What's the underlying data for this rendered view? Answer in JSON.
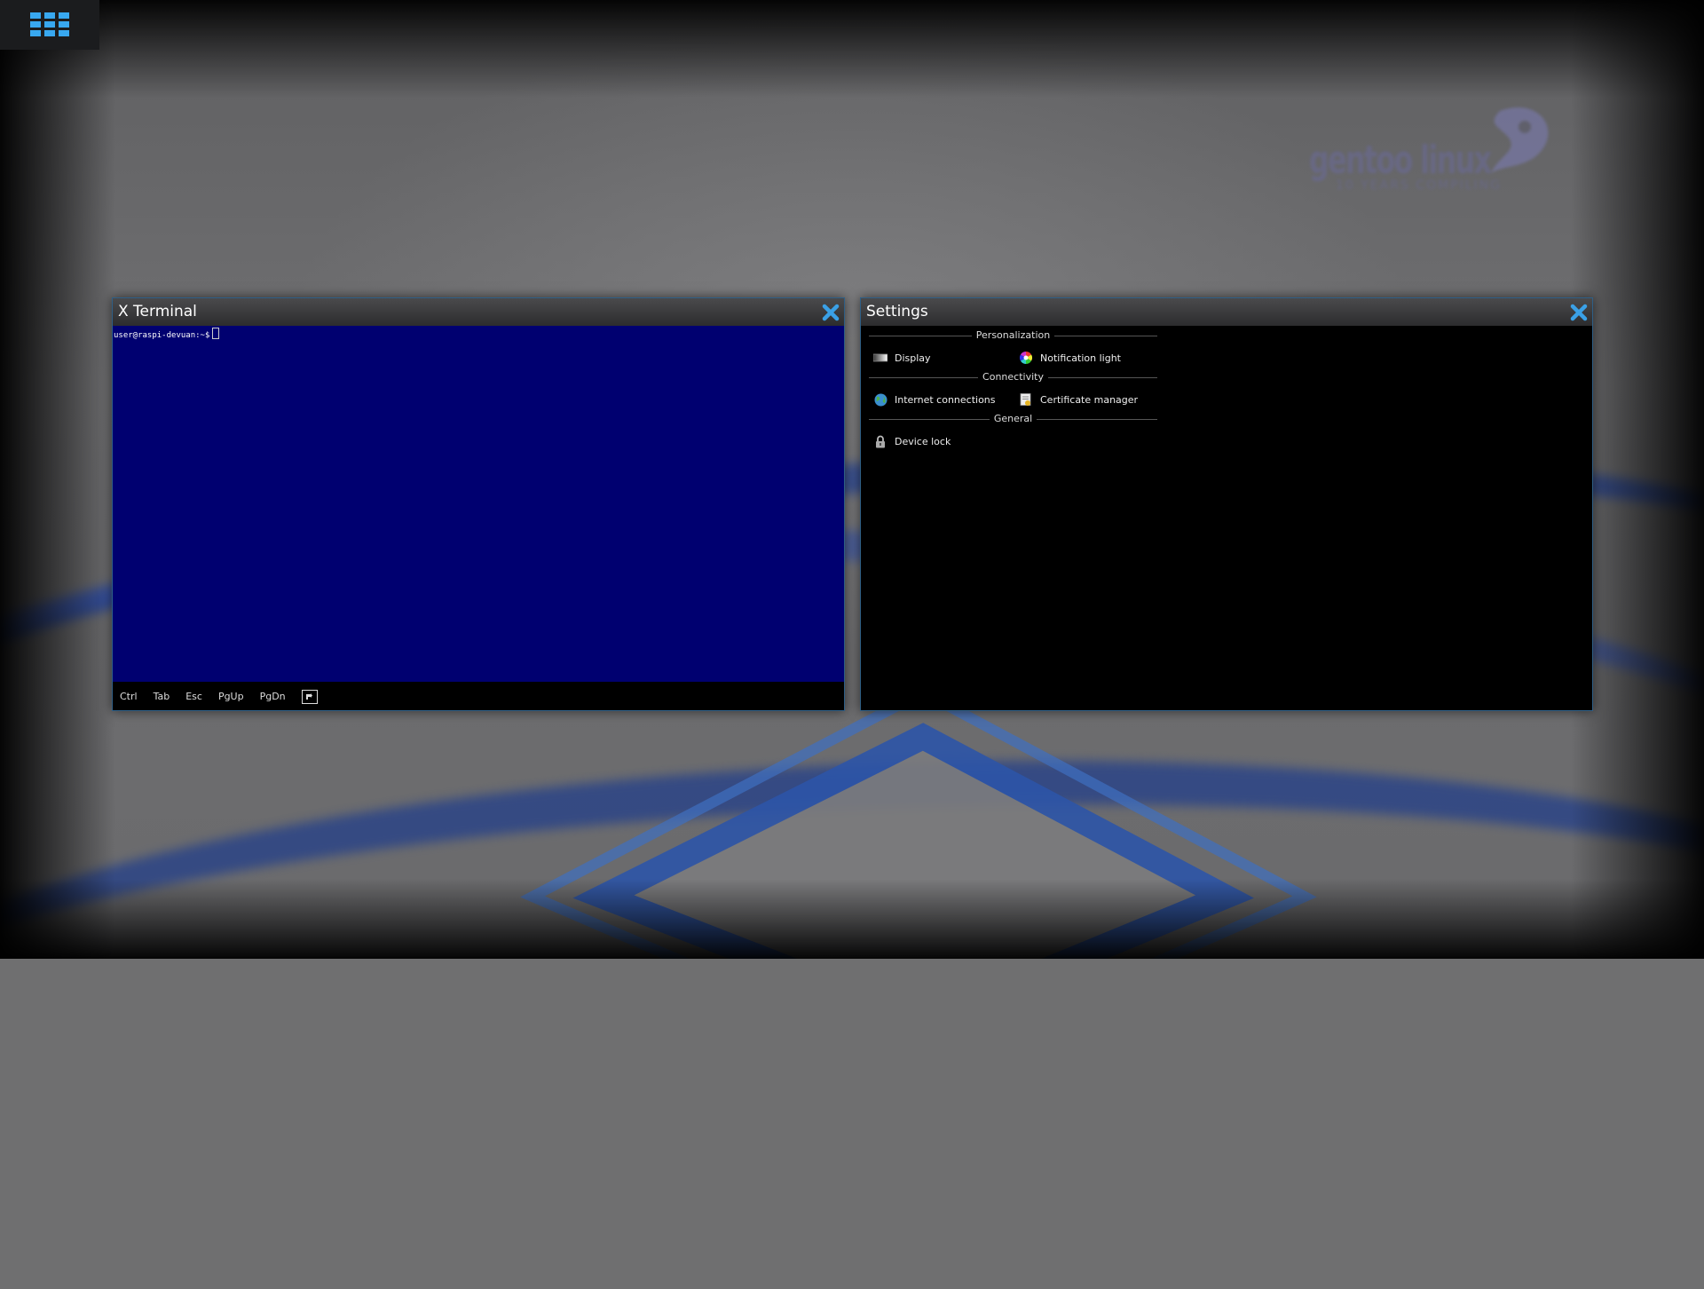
{
  "launcher": {
    "icon": "app-grid-icon"
  },
  "wallpaper": {
    "logo_text": "gentoo linux",
    "logo_subtext": "10 YEARS COMPILING"
  },
  "terminal": {
    "title": "X Terminal",
    "prompt": "user@raspi-devuan:~$",
    "keys": [
      "Ctrl",
      "Tab",
      "Esc",
      "PgUp",
      "PgDn"
    ],
    "body_color": "#000070"
  },
  "settings": {
    "title": "Settings",
    "sections": [
      {
        "label": "Personalization",
        "items": [
          {
            "label": "Display",
            "icon": "display-icon"
          },
          {
            "label": "Notification light",
            "icon": "notification-light-icon"
          }
        ]
      },
      {
        "label": "Connectivity",
        "items": [
          {
            "label": "Internet connections",
            "icon": "globe-icon"
          },
          {
            "label": "Certificate manager",
            "icon": "certificate-icon"
          }
        ]
      },
      {
        "label": "General",
        "items": [
          {
            "label": "Device lock",
            "icon": "lock-icon"
          }
        ]
      }
    ]
  },
  "colors": {
    "accent": "#3aa0e6",
    "window_border": "#2f5f86"
  }
}
